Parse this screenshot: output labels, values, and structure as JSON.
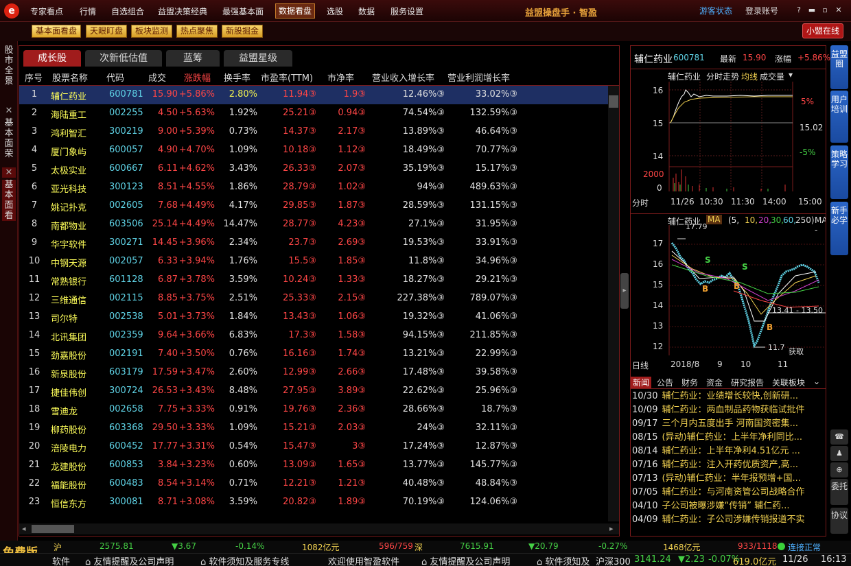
{
  "menu": [
    "专家看点",
    "行情",
    "自选组合",
    "益盟决策经典",
    "最强基本面",
    "数据看盘",
    "选股",
    "数据",
    "服务设置"
  ],
  "active_menu": 5,
  "app_title": "益盟操盘手 · 智盈",
  "guest": "游客状态",
  "login": "登录账号",
  "win_buttons": [
    "?",
    "▬",
    "▫",
    "✕"
  ],
  "logo_char": "e",
  "toolbar": [
    "基本面看盘",
    "天眼盯盘",
    "板块监测",
    "热点聚焦",
    "新股掘金"
  ],
  "xmzx": "小盟在线",
  "left_tabs": [
    "股市全景",
    "✕",
    "基本面荣",
    "✕",
    "基本面看"
  ],
  "subtabs": [
    "成长股",
    "次新低估值",
    "蓝筹",
    "益盟星级"
  ],
  "headers": [
    "序号",
    "股票名称",
    "代码",
    "成交",
    "涨跌幅",
    "换手率",
    "市盈率(TTM)",
    "市净率",
    "营业收入增长率",
    "营业利润增长率"
  ],
  "rows": [
    [
      "1",
      "辅仁药业",
      "600781",
      "15.90",
      "+5.86%",
      "2.80%",
      "11.94③",
      "1.9③",
      "12.46%③",
      "33.02%③"
    ],
    [
      "2",
      "海陆重工",
      "002255",
      "4.50",
      "+5.63%",
      "1.92%",
      "25.21③",
      "0.94③",
      "74.54%③",
      "132.59%③"
    ],
    [
      "3",
      "鸿利智汇",
      "300219",
      "9.00",
      "+5.39%",
      "0.73%",
      "14.37③",
      "2.17③",
      "13.89%③",
      "46.64%③"
    ],
    [
      "4",
      "厦门象屿",
      "600057",
      "4.90",
      "+4.70%",
      "1.09%",
      "10.18③",
      "1.12③",
      "18.49%③",
      "70.77%③"
    ],
    [
      "5",
      "太极实业",
      "600667",
      "6.11",
      "+4.62%",
      "3.43%",
      "26.33③",
      "2.07③",
      "35.19%③",
      "15.17%③"
    ],
    [
      "6",
      "亚光科技",
      "300123",
      "8.51",
      "+4.55%",
      "1.86%",
      "28.79③",
      "1.02③",
      "94%③",
      "489.63%③"
    ],
    [
      "7",
      "姚记扑克",
      "002605",
      "7.68",
      "+4.49%",
      "4.17%",
      "29.85③",
      "1.87③",
      "28.59%③",
      "131.15%③"
    ],
    [
      "8",
      "南都物业",
      "603506",
      "25.14",
      "+4.49%",
      "14.47%",
      "28.77③",
      "4.23③",
      "27.1%③",
      "31.95%③"
    ],
    [
      "9",
      "华宇软件",
      "300271",
      "14.45",
      "+3.96%",
      "2.34%",
      "23.7③",
      "2.69③",
      "19.53%③",
      "33.91%③"
    ],
    [
      "10",
      "中钢天源",
      "002057",
      "6.33",
      "+3.94%",
      "1.76%",
      "15.5③",
      "1.85③",
      "11.8%③",
      "34.96%③"
    ],
    [
      "11",
      "常熟银行",
      "601128",
      "6.87",
      "+3.78%",
      "3.59%",
      "10.24③",
      "1.33③",
      "18.27%③",
      "29.21%③"
    ],
    [
      "12",
      "三维通信",
      "002115",
      "8.85",
      "+3.75%",
      "2.51%",
      "25.33③",
      "2.15③",
      "227.38%③",
      "789.07%③"
    ],
    [
      "13",
      "司尔特",
      "002538",
      "5.01",
      "+3.73%",
      "1.84%",
      "13.43③",
      "1.06③",
      "19.32%③",
      "41.06%③"
    ],
    [
      "14",
      "北讯集团",
      "002359",
      "9.64",
      "+3.66%",
      "6.83%",
      "17.3③",
      "1.58③",
      "94.15%③",
      "211.85%③"
    ],
    [
      "15",
      "劲嘉股份",
      "002191",
      "7.40",
      "+3.50%",
      "0.76%",
      "16.16③",
      "1.74③",
      "13.21%③",
      "22.99%③"
    ],
    [
      "16",
      "新泉股份",
      "603179",
      "17.59",
      "+3.47%",
      "2.60%",
      "12.99③",
      "2.66③",
      "17.48%③",
      "39.58%③"
    ],
    [
      "17",
      "捷佳伟创",
      "300724",
      "26.53",
      "+3.43%",
      "8.48%",
      "27.95③",
      "3.89③",
      "22.62%③",
      "25.96%③"
    ],
    [
      "18",
      "雪迪龙",
      "002658",
      "7.75",
      "+3.33%",
      "0.91%",
      "19.76③",
      "2.36③",
      "28.66%③",
      "18.7%③"
    ],
    [
      "19",
      "柳药股份",
      "603368",
      "29.50",
      "+3.33%",
      "1.09%",
      "15.21③",
      "2.03③",
      "24%③",
      "32.11%③"
    ],
    [
      "20",
      "涪陵电力",
      "600452",
      "17.77",
      "+3.31%",
      "0.54%",
      "15.47③",
      "3③",
      "17.24%③",
      "12.87%③"
    ],
    [
      "21",
      "龙建股份",
      "600853",
      "3.84",
      "+3.23%",
      "0.60%",
      "13.09③",
      "1.65③",
      "13.77%③",
      "145.77%③"
    ],
    [
      "22",
      "福能股份",
      "600483",
      "8.54",
      "+3.14%",
      "0.71%",
      "12.21③",
      "1.21③",
      "40.48%③",
      "48.84%③"
    ],
    [
      "23",
      "恒信东方",
      "300081",
      "8.71",
      "+3.08%",
      "3.59%",
      "20.82③",
      "1.89③",
      "70.19%③",
      "124.06%③"
    ]
  ],
  "stock": {
    "name": "辅仁药业",
    "code": "600781",
    "latest_label": "最新",
    "latest": "15.90",
    "change_label": "涨幅",
    "change": "+5.86%"
  },
  "intraday": {
    "title_name": "辅仁药业",
    "mode": "分时走势",
    "avg": "均线",
    "vol": "成交量",
    "y_labels": [
      "16",
      "15",
      "14"
    ],
    "right_labels": [
      "5%",
      "15.02",
      "-5%"
    ],
    "vol_labels": [
      "2000",
      "0"
    ],
    "time_label": "分时",
    "times": [
      "11/26",
      "10:30",
      "11:30",
      "14:00",
      "15:00"
    ]
  },
  "daily": {
    "title_name": "辅仁药业",
    "ma": "MA",
    "params": [
      "(5,",
      "10,",
      "20,",
      "30,",
      "60,",
      "250)",
      "MA?-"
    ],
    "y_labels": [
      "17",
      "16",
      "15",
      "14",
      "13",
      "12"
    ],
    "high": "17.79",
    "low": "11.7",
    "range": "13.41 - 13.50",
    "get": "获取",
    "time_label": "日线",
    "times": [
      "2018/8",
      "9",
      "10",
      "11"
    ],
    "marks": [
      "S",
      "S",
      "B",
      "B",
      "B"
    ]
  },
  "news_tabs": [
    "新闻",
    "公告",
    "财务",
    "资金",
    "研究报告",
    "关联板块"
  ],
  "news": [
    [
      "10/30",
      "辅仁药业：业绩增长较快,创新研..."
    ],
    [
      "10/09",
      "辅仁药业：两血制品药物获临试批件"
    ],
    [
      "09/17",
      "三个月内五度出手 河南国资密集..."
    ],
    [
      "08/15",
      "(异动)辅仁药业：上半年净利同比..."
    ],
    [
      "08/14",
      "辅仁药业：上半年净利4.51亿元 ..."
    ],
    [
      "07/16",
      "辅仁药业：注入开药优质资产,高..."
    ],
    [
      "07/13",
      "(异动)辅仁药业：半年报预增+国..."
    ],
    [
      "07/05",
      "辅仁药业：与河南资管公司战略合作"
    ],
    [
      "04/10",
      "子公司被曝涉嫌“传销” 辅仁药..."
    ],
    [
      "04/09",
      "辅仁药业：子公司涉嫌传销报道不实"
    ]
  ],
  "right_buttons": [
    "益盟圈",
    "用户培训",
    "策略学习",
    "新手必学"
  ],
  "right_icons": [
    "☎",
    "♟",
    "⊕"
  ],
  "right_small": [
    "委托",
    "协议"
  ],
  "status1": {
    "free": "免费版",
    "sh_label": "沪",
    "sh_val": "2575.81",
    "sh_chg": "▼3.67",
    "sh_pct": "-0.14%",
    "sh_amt": "1082亿元",
    "sh_ud": "596/759",
    "sz_label": "深",
    "sz_val": "7615.91",
    "sz_chg": "▼20.79",
    "sz_pct": "-0.27%",
    "sz_amt": "1468亿元",
    "sz_ud": "933/1118",
    "conn": "连接正常"
  },
  "status2": {
    "left": "软件",
    "items": [
      "友情提醒及公司声明",
      "软件须知及服务专线",
      "欢迎使用智盈软件",
      "友情提醒及公司声明",
      "软件须知及"
    ],
    "hs300_label": "沪深300",
    "hs300": "3141.24",
    "hs300_chg": "▼2.23",
    "hs300_pct": "-0.07%",
    "hs300_amt": "619.0亿元",
    "date": "11/26",
    "time": "16:13"
  }
}
